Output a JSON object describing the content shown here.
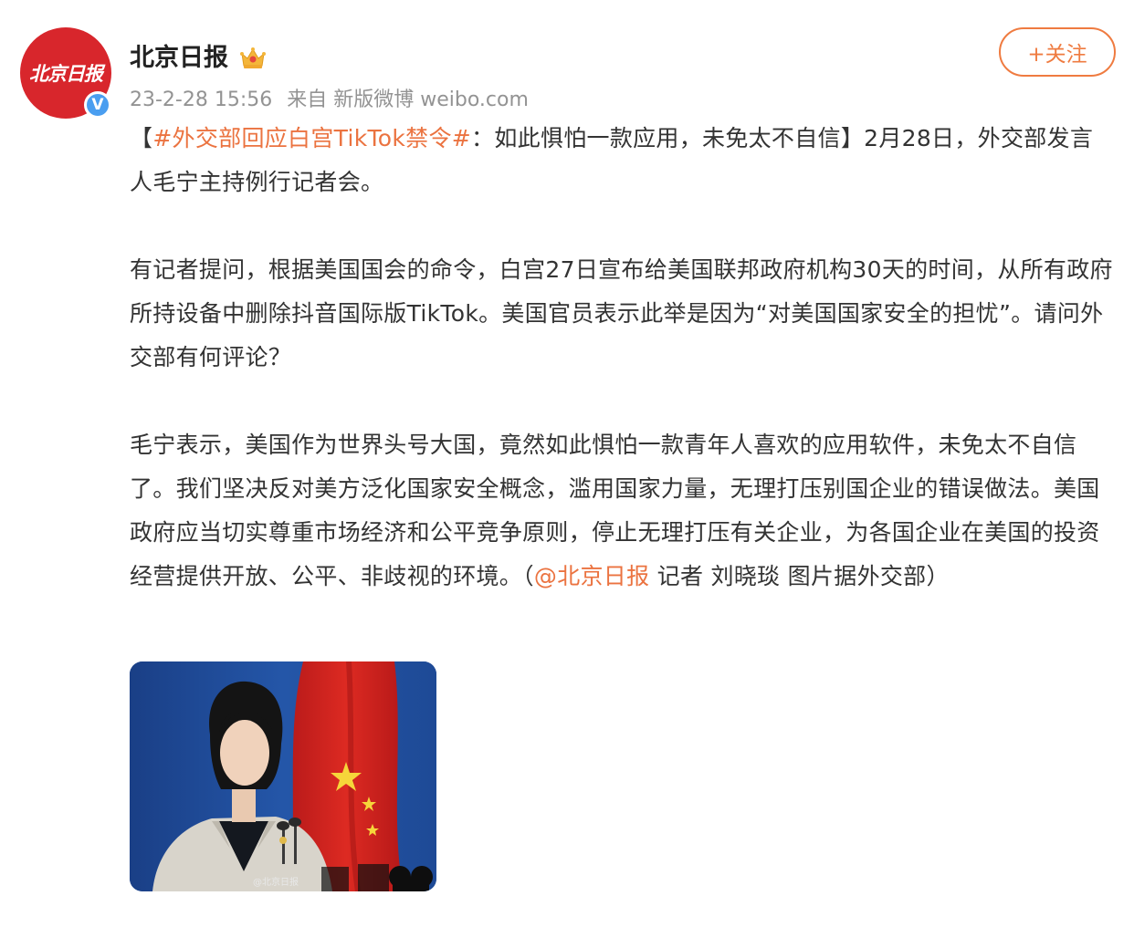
{
  "account": {
    "name": "北京日报",
    "avatar_text": "北京日报",
    "verified_mark": "V",
    "badge_icon": "crown-icon"
  },
  "post_meta": {
    "time": "23-2-28 15:56",
    "source": "来自 新版微博 weibo.com"
  },
  "follow_label": "+关注",
  "content": {
    "p1_bracket_open": "【",
    "p1_hashtag": "#外交部回应白宫TikTok禁令#",
    "p1_rest": "：如此惧怕一款应用，未免太不自信】2月28日，外交部发言人毛宁主持例行记者会。",
    "p2": "有记者提问，根据美国国会的命令，白宫27日宣布给美国联邦政府机构30天的时间，从所有政府所持设备中删除抖音国际版TikTok。美国官员表示此举是因为“对美国国家安全的担忧”。请问外交部有何评论？",
    "p3_before": "毛宁表示，美国作为世界头号大国，竟然如此惧怕一款青年人喜欢的应用软件，未免太不自信了。我们坚决反对美方泛化国家安全概念，滥用国家力量，无理打压别国企业的错误做法。美国政府应当切实尊重市场经济和公平竞争原则，停止无理打压有关企业，为各国企业在美国的投资经营提供开放、公平、非歧视的环境。（",
    "p3_mention": "@北京日报",
    "p3_after": " 记者 刘晓琰 图片据外交部）"
  },
  "image": {
    "watermark": "@北京日报"
  },
  "colors": {
    "accent": "#eb7340",
    "avatar_bg": "#d8262c",
    "verified": "#4a9ef0",
    "meta_gray": "#939393"
  }
}
